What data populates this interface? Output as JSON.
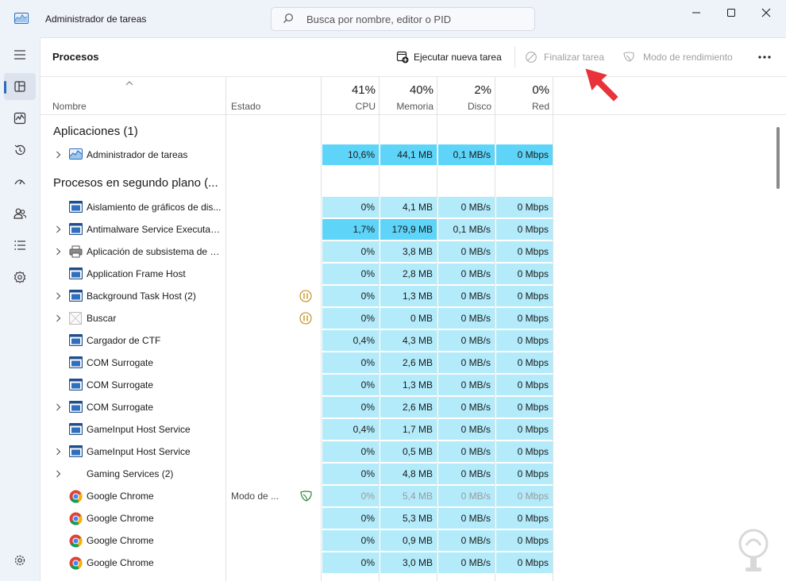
{
  "window": {
    "title": "Administrador de tareas",
    "search_placeholder": "Busca por nombre, editor o PID"
  },
  "nav": {
    "items": [
      {
        "name": "hamburger-menu",
        "icon": "menu-icon"
      },
      {
        "name": "procesos",
        "icon": "processes-icon",
        "active": true
      },
      {
        "name": "rendimiento",
        "icon": "performance-icon"
      },
      {
        "name": "historial",
        "icon": "history-icon"
      },
      {
        "name": "inicio",
        "icon": "startup-icon"
      },
      {
        "name": "usuarios",
        "icon": "users-icon"
      },
      {
        "name": "detalles",
        "icon": "details-icon"
      },
      {
        "name": "servicios",
        "icon": "services-icon"
      },
      {
        "name": "configuracion",
        "icon": "settings-icon"
      }
    ]
  },
  "toolbar": {
    "page_title": "Procesos",
    "run_new_task": "Ejecutar nueva tarea",
    "end_task": "Finalizar tarea",
    "efficiency_mode": "Modo de rendimiento"
  },
  "columns": {
    "name": "Nombre",
    "status": "Estado",
    "cpu": {
      "percent": "41%",
      "label": "CPU"
    },
    "memory": {
      "percent": "40%",
      "label": "Memoria"
    },
    "disk": {
      "percent": "2%",
      "label": "Disco"
    },
    "network": {
      "percent": "0%",
      "label": "Red"
    }
  },
  "groups": {
    "apps": "Aplicaciones (1)",
    "background": "Procesos en segundo plano (..."
  },
  "processes": [
    {
      "name": "Administrador de tareas",
      "icon": "taskmgr-icon",
      "expandable": true,
      "status": "",
      "state_icon": "",
      "cpu": "10,6%",
      "mem": "44,1 MB",
      "disk": "0,1 MB/s",
      "net": "0 Mbps",
      "group": "apps"
    },
    {
      "name": "Aislamiento de gráficos de dis...",
      "icon": "window-icon",
      "expandable": false,
      "status": "",
      "state_icon": "",
      "cpu": "0%",
      "mem": "4,1 MB",
      "disk": "0 MB/s",
      "net": "0 Mbps"
    },
    {
      "name": "Antimalware Service Executable",
      "icon": "window-icon",
      "expandable": true,
      "status": "",
      "state_icon": "",
      "cpu": "1,7%",
      "mem": "179,9 MB",
      "disk": "0,1 MB/s",
      "net": "0 Mbps"
    },
    {
      "name": "Aplicación de subsistema de c...",
      "icon": "printer-icon",
      "expandable": true,
      "status": "",
      "state_icon": "",
      "cpu": "0%",
      "mem": "3,8 MB",
      "disk": "0 MB/s",
      "net": "0 Mbps"
    },
    {
      "name": "Application Frame Host",
      "icon": "window-icon",
      "expandable": false,
      "status": "",
      "state_icon": "",
      "cpu": "0%",
      "mem": "2,8 MB",
      "disk": "0 MB/s",
      "net": "0 Mbps"
    },
    {
      "name": "Background Task Host (2)",
      "icon": "window-icon",
      "expandable": true,
      "status": "",
      "state_icon": "paused-icon",
      "cpu": "0%",
      "mem": "1,3 MB",
      "disk": "0 MB/s",
      "net": "0 Mbps"
    },
    {
      "name": "Buscar",
      "icon": "blank-icon",
      "expandable": true,
      "status": "",
      "state_icon": "paused-icon",
      "cpu": "0%",
      "mem": "0 MB",
      "disk": "0 MB/s",
      "net": "0 Mbps"
    },
    {
      "name": "Cargador de CTF",
      "icon": "window-icon",
      "expandable": false,
      "status": "",
      "state_icon": "",
      "cpu": "0,4%",
      "mem": "4,3 MB",
      "disk": "0 MB/s",
      "net": "0 Mbps"
    },
    {
      "name": "COM Surrogate",
      "icon": "window-icon",
      "expandable": false,
      "status": "",
      "state_icon": "",
      "cpu": "0%",
      "mem": "2,6 MB",
      "disk": "0 MB/s",
      "net": "0 Mbps"
    },
    {
      "name": "COM Surrogate",
      "icon": "window-icon",
      "expandable": false,
      "status": "",
      "state_icon": "",
      "cpu": "0%",
      "mem": "1,3 MB",
      "disk": "0 MB/s",
      "net": "0 Mbps"
    },
    {
      "name": "COM Surrogate",
      "icon": "window-icon",
      "expandable": true,
      "status": "",
      "state_icon": "",
      "cpu": "0%",
      "mem": "2,6 MB",
      "disk": "0 MB/s",
      "net": "0 Mbps"
    },
    {
      "name": "GameInput Host Service",
      "icon": "window-icon",
      "expandable": false,
      "status": "",
      "state_icon": "",
      "cpu": "0,4%",
      "mem": "1,7 MB",
      "disk": "0 MB/s",
      "net": "0 Mbps"
    },
    {
      "name": "GameInput Host Service",
      "icon": "window-icon",
      "expandable": true,
      "status": "",
      "state_icon": "",
      "cpu": "0%",
      "mem": "0,5 MB",
      "disk": "0 MB/s",
      "net": "0 Mbps"
    },
    {
      "name": "Gaming Services (2)",
      "icon": "none",
      "expandable": true,
      "status": "",
      "state_icon": "",
      "cpu": "0%",
      "mem": "4,8 MB",
      "disk": "0 MB/s",
      "net": "0 Mbps"
    },
    {
      "name": "Google Chrome",
      "icon": "chrome-icon",
      "expandable": false,
      "status": "Modo de ...",
      "state_icon": "leaf-icon",
      "dim": true,
      "cpu": "0%",
      "mem": "5,4 MB",
      "disk": "0 MB/s",
      "net": "0 Mbps"
    },
    {
      "name": "Google Chrome",
      "icon": "chrome-icon",
      "expandable": false,
      "status": "",
      "state_icon": "",
      "cpu": "0%",
      "mem": "5,3 MB",
      "disk": "0 MB/s",
      "net": "0 Mbps"
    },
    {
      "name": "Google Chrome",
      "icon": "chrome-icon",
      "expandable": false,
      "status": "",
      "state_icon": "",
      "cpu": "0%",
      "mem": "0,9 MB",
      "disk": "0 MB/s",
      "net": "0 Mbps"
    },
    {
      "name": "Google Chrome",
      "icon": "chrome-icon",
      "expandable": false,
      "status": "",
      "state_icon": "",
      "cpu": "0%",
      "mem": "3,0 MB",
      "disk": "0 MB/s",
      "net": "0 Mbps"
    }
  ],
  "colors": {
    "heat_light": "#b3ebfb",
    "heat_medium": "#5dd4f8",
    "accent": "#2b6cb8",
    "annotation_red": "#e8333a"
  }
}
